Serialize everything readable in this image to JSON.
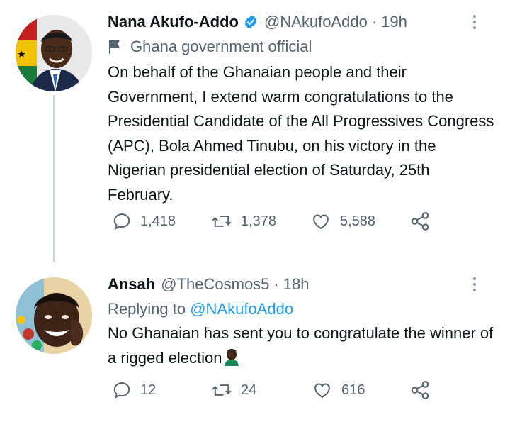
{
  "tweets": [
    {
      "display_name": "Nana Akufo-Addo",
      "verified": true,
      "handle": "@NAkufoAddo",
      "separator": "·",
      "time": "19h",
      "affiliation_label": "Ghana government official",
      "text": "On behalf of the Ghanaian people and their Government, I extend warm congratulations to the Presidential Candidate of the All Progressives Congress (APC), Bola Ahmed Tinubu, on his victory in the Nigerian presidential election of Saturday, 25th February.",
      "replies": "1,418",
      "retweets": "1,378",
      "likes": "5,588"
    },
    {
      "display_name": "Ansah",
      "handle": "@TheCosmos5",
      "separator": "·",
      "time": "18h",
      "replying_prefix": "Replying to",
      "replying_handle": "@NAkufoAddo",
      "text": "No Ghanaian has sent you to congratulate the winner of a rigged election",
      "replies": "12",
      "retweets": "24",
      "likes": "616"
    }
  ],
  "colors": {
    "secondary_text": "#536471",
    "primary_text": "#0f1419",
    "accent": "#1d9bf0",
    "thread_line": "#cfd9de"
  }
}
